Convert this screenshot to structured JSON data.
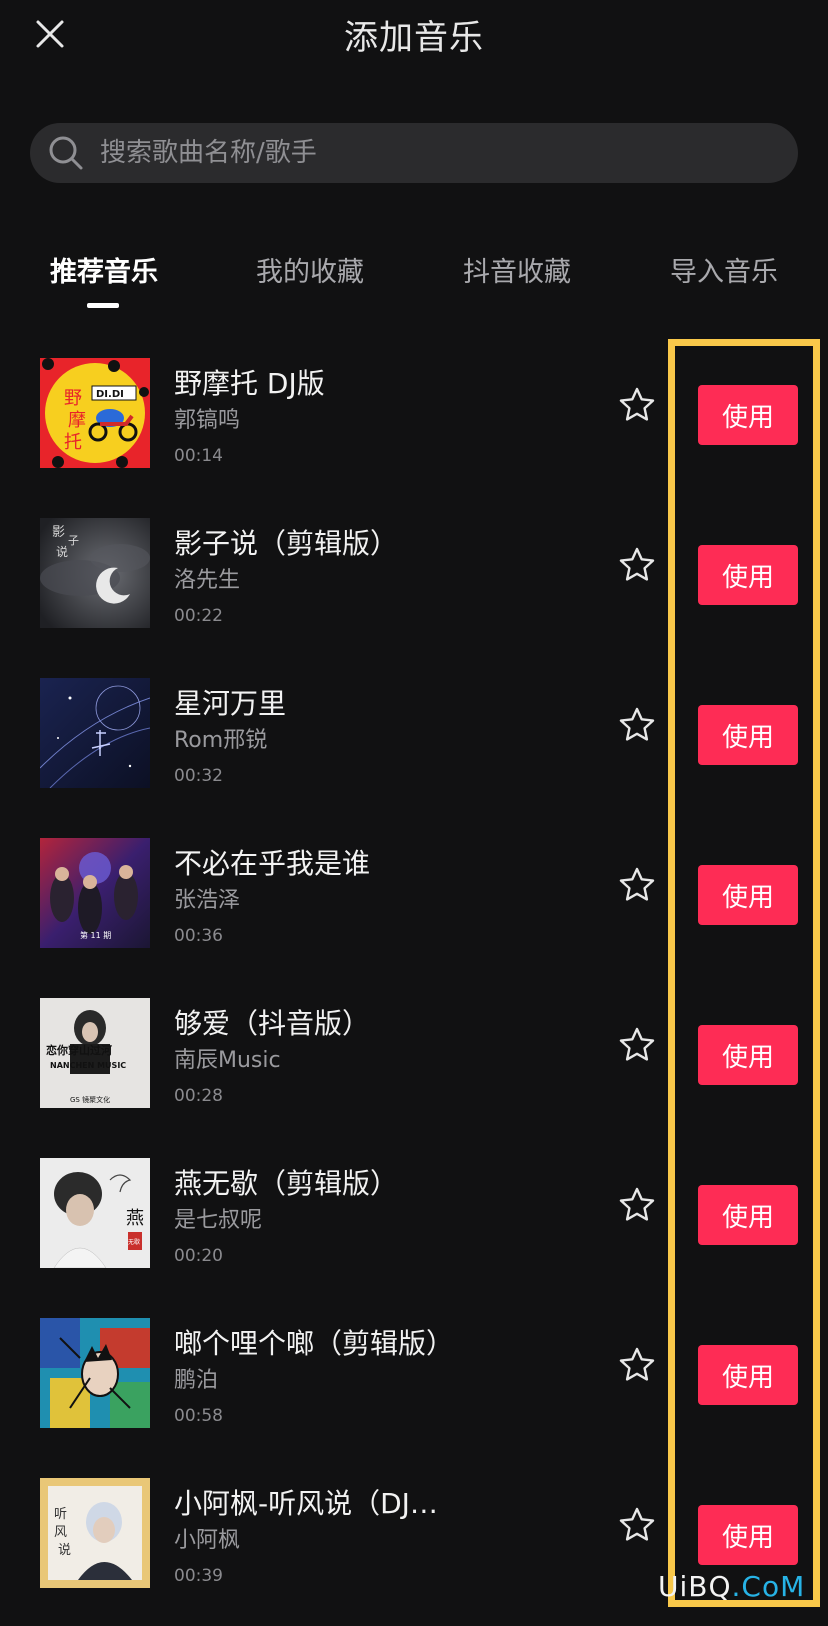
{
  "header": {
    "title": "添加音乐"
  },
  "search": {
    "placeholder": "搜索歌曲名称/歌手"
  },
  "tabs": [
    {
      "label": "推荐音乐",
      "active": true
    },
    {
      "label": "我的收藏",
      "active": false
    },
    {
      "label": "抖音收藏",
      "active": false
    },
    {
      "label": "导入音乐",
      "active": false
    }
  ],
  "songs": [
    {
      "title": "野摩托 DJ版",
      "artist": "郭镐鸣",
      "duration": "00:14",
      "use_label": "使用"
    },
    {
      "title": "影子说（剪辑版）",
      "artist": "洛先生",
      "duration": "00:22",
      "use_label": "使用"
    },
    {
      "title": " 星河万里",
      "artist": "Rom邢锐",
      "duration": "00:32",
      "use_label": "使用"
    },
    {
      "title": "不必在乎我是谁",
      "artist": "张浩泽",
      "duration": "00:36",
      "use_label": "使用"
    },
    {
      "title": "够爱（抖音版）",
      "artist": "南辰Music",
      "duration": "00:28",
      "use_label": "使用"
    },
    {
      "title": "燕无歇（剪辑版）",
      "artist": "是七叔呢",
      "duration": "00:20",
      "use_label": "使用"
    },
    {
      "title": "啷个哩个啷（剪辑版）",
      "artist": "鹏泊",
      "duration": "00:58",
      "use_label": "使用"
    },
    {
      "title": "小阿枫-听风说（DJ…",
      "artist": "小阿枫",
      "duration": "00:39",
      "use_label": "使用"
    }
  ],
  "covers": {
    "c0": {
      "text_a": "野",
      "text_b": "摩",
      "text_c": "托",
      "badge": "DI.DI"
    },
    "c1": {
      "text_a": "影",
      "text_b": "子",
      "text_c": "说"
    },
    "c3": {
      "text_a": "第 11 期"
    },
    "c4": {
      "text_a": "恋你穿山过河",
      "text_b": "NANCHEN MUSIC",
      "text_c": "GS 镜聚文化"
    },
    "c5": {
      "text_a": "燕",
      "text_b": "无歇"
    },
    "c7": {
      "text_a": "听",
      "text_b": "风",
      "text_c": "说"
    }
  },
  "watermark": {
    "prefix": "UiBQ",
    "suffix": ".CoM"
  },
  "colors": {
    "accent": "#fe2c55",
    "highlight": "#f9c84a",
    "background": "#111112"
  }
}
